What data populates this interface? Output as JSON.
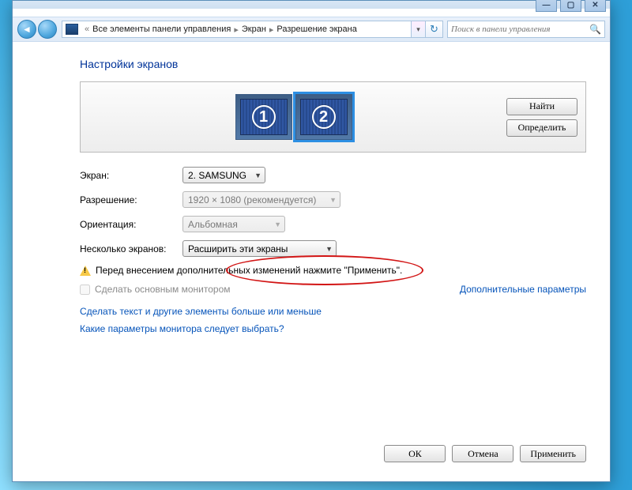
{
  "wincontrols": {
    "min": "—",
    "max": "▢",
    "close": "✕"
  },
  "nav": {
    "back": "◄",
    "fwd": "",
    "level_up": "«",
    "seg1": "Все элементы панели управления",
    "seg2": "Экран",
    "seg3": "Разрешение экрана",
    "chev": "▸",
    "drop": "▾",
    "refresh": "↻"
  },
  "search": {
    "placeholder": "Поиск в панели управления"
  },
  "heading": "Настройки экранов",
  "monitors": {
    "m1": "1",
    "m2": "2"
  },
  "sidebuttons": {
    "find": "Найти",
    "identify": "Определить"
  },
  "form": {
    "screen_label": "Экран:",
    "screen_value": "2. SAMSUNG",
    "resolution_label": "Разрешение:",
    "resolution_value": "1920 × 1080 (рекомендуется)",
    "orientation_label": "Ориентация:",
    "orientation_value": "Альбомная",
    "multi_label": "Несколько экранов:",
    "multi_value": "Расширить эти экраны"
  },
  "warning": "Перед внесением дополнительных изменений нажмите \"Применить\".",
  "make_primary": "Сделать основным монитором",
  "adv_params": "Дополнительные параметры",
  "link1": "Сделать текст и другие элементы больше или меньше",
  "link2": "Какие параметры монитора следует выбрать?",
  "buttons": {
    "ok": "ОК",
    "cancel": "Отмена",
    "apply": "Применить"
  }
}
